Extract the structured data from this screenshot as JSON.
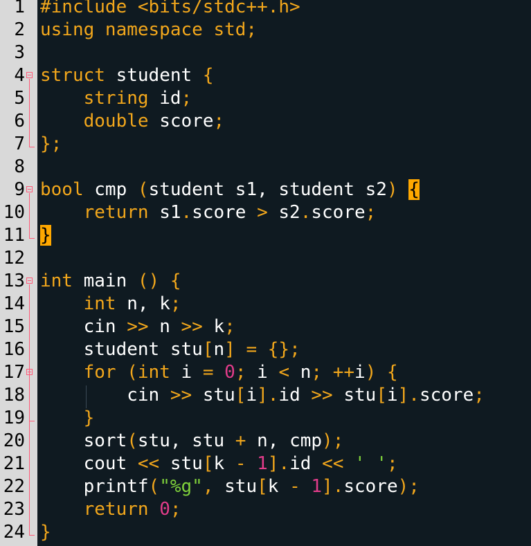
{
  "editor": {
    "name": "C++ source editor",
    "line_numbers": [
      "1",
      "2",
      "3",
      "4",
      "5",
      "6",
      "7",
      "8",
      "9",
      "10",
      "11",
      "12",
      "13",
      "14",
      "15",
      "16",
      "17",
      "18",
      "19",
      "20",
      "21",
      "22",
      "23",
      "24"
    ],
    "lines": [
      [
        {
          "t": "#include <bits/stdc++.h>",
          "c": "pp"
        }
      ],
      [
        {
          "t": "using namespace std",
          "c": "ty"
        },
        {
          "t": ";",
          "c": "op"
        }
      ],
      [],
      [
        {
          "t": "struct ",
          "c": "ty"
        },
        {
          "t": "student ",
          "c": "id"
        },
        {
          "t": "{",
          "c": "op"
        }
      ],
      [
        {
          "t": "    ",
          "c": "id"
        },
        {
          "t": "string ",
          "c": "ty"
        },
        {
          "t": "id",
          "c": "id"
        },
        {
          "t": ";",
          "c": "op"
        }
      ],
      [
        {
          "t": "    ",
          "c": "id"
        },
        {
          "t": "double ",
          "c": "ty"
        },
        {
          "t": "score",
          "c": "id"
        },
        {
          "t": ";",
          "c": "op"
        }
      ],
      [
        {
          "t": "}",
          "c": "op"
        },
        {
          "t": ";",
          "c": "op"
        }
      ],
      [],
      [
        {
          "t": "bool ",
          "c": "ty"
        },
        {
          "t": "cmp ",
          "c": "id"
        },
        {
          "t": "(",
          "c": "op"
        },
        {
          "t": "student ",
          "c": "id"
        },
        {
          "t": "s1, ",
          "c": "id"
        },
        {
          "t": "student ",
          "c": "id"
        },
        {
          "t": "s2",
          "c": "id"
        },
        {
          "t": ") ",
          "c": "op"
        },
        {
          "t": "{",
          "c": "match"
        }
      ],
      [
        {
          "t": "    ",
          "c": "id"
        },
        {
          "t": "return ",
          "c": "ctl"
        },
        {
          "t": "s1",
          "c": "id"
        },
        {
          "t": ".",
          "c": "op"
        },
        {
          "t": "score ",
          "c": "id"
        },
        {
          "t": "> ",
          "c": "op"
        },
        {
          "t": "s2",
          "c": "id"
        },
        {
          "t": ".",
          "c": "op"
        },
        {
          "t": "score",
          "c": "id"
        },
        {
          "t": ";",
          "c": "op"
        }
      ],
      [
        {
          "t": "}",
          "c": "match"
        }
      ],
      [],
      [
        {
          "t": "int ",
          "c": "ty"
        },
        {
          "t": "main ",
          "c": "id"
        },
        {
          "t": "() ",
          "c": "op"
        },
        {
          "t": "{",
          "c": "op"
        }
      ],
      [
        {
          "t": "    ",
          "c": "id"
        },
        {
          "t": "int ",
          "c": "ty"
        },
        {
          "t": "n, k",
          "c": "id"
        },
        {
          "t": ";",
          "c": "op"
        }
      ],
      [
        {
          "t": "    ",
          "c": "id"
        },
        {
          "t": "cin ",
          "c": "id"
        },
        {
          "t": ">> ",
          "c": "op"
        },
        {
          "t": "n ",
          "c": "id"
        },
        {
          "t": ">> ",
          "c": "op"
        },
        {
          "t": "k",
          "c": "id"
        },
        {
          "t": ";",
          "c": "op"
        }
      ],
      [
        {
          "t": "    ",
          "c": "id"
        },
        {
          "t": "student ",
          "c": "id"
        },
        {
          "t": "stu",
          "c": "id"
        },
        {
          "t": "[",
          "c": "op"
        },
        {
          "t": "n",
          "c": "id"
        },
        {
          "t": "] = {}",
          "c": "op"
        },
        {
          "t": ";",
          "c": "op"
        }
      ],
      [
        {
          "t": "    ",
          "c": "id"
        },
        {
          "t": "for ",
          "c": "ctl"
        },
        {
          "t": "(",
          "c": "op"
        },
        {
          "t": "int ",
          "c": "ty"
        },
        {
          "t": "i ",
          "c": "id"
        },
        {
          "t": "= ",
          "c": "op"
        },
        {
          "t": "0",
          "c": "num"
        },
        {
          "t": "; ",
          "c": "op"
        },
        {
          "t": "i ",
          "c": "id"
        },
        {
          "t": "< ",
          "c": "op"
        },
        {
          "t": "n",
          "c": "id"
        },
        {
          "t": "; ",
          "c": "op"
        },
        {
          "t": "++",
          "c": "op"
        },
        {
          "t": "i",
          "c": "id"
        },
        {
          "t": ") {",
          "c": "op"
        }
      ],
      [
        {
          "t": "        ",
          "c": "id"
        },
        {
          "t": "cin ",
          "c": "id"
        },
        {
          "t": ">> ",
          "c": "op"
        },
        {
          "t": "stu",
          "c": "id"
        },
        {
          "t": "[",
          "c": "op"
        },
        {
          "t": "i",
          "c": "id"
        },
        {
          "t": "]",
          "c": "op"
        },
        {
          "t": ".",
          "c": "op"
        },
        {
          "t": "id ",
          "c": "id"
        },
        {
          "t": ">> ",
          "c": "op"
        },
        {
          "t": "stu",
          "c": "id"
        },
        {
          "t": "[",
          "c": "op"
        },
        {
          "t": "i",
          "c": "id"
        },
        {
          "t": "]",
          "c": "op"
        },
        {
          "t": ".",
          "c": "op"
        },
        {
          "t": "score",
          "c": "id"
        },
        {
          "t": ";",
          "c": "op"
        }
      ],
      [
        {
          "t": "    ",
          "c": "id"
        },
        {
          "t": "}",
          "c": "op"
        }
      ],
      [
        {
          "t": "    ",
          "c": "id"
        },
        {
          "t": "sort",
          "c": "id"
        },
        {
          "t": "(",
          "c": "op"
        },
        {
          "t": "stu, stu ",
          "c": "id"
        },
        {
          "t": "+ ",
          "c": "op"
        },
        {
          "t": "n, cmp",
          "c": "id"
        },
        {
          "t": ")",
          "c": "op"
        },
        {
          "t": ";",
          "c": "op"
        }
      ],
      [
        {
          "t": "    ",
          "c": "id"
        },
        {
          "t": "cout ",
          "c": "id"
        },
        {
          "t": "<< ",
          "c": "op"
        },
        {
          "t": "stu",
          "c": "id"
        },
        {
          "t": "[",
          "c": "op"
        },
        {
          "t": "k ",
          "c": "id"
        },
        {
          "t": "- ",
          "c": "op"
        },
        {
          "t": "1",
          "c": "num"
        },
        {
          "t": "]",
          "c": "op"
        },
        {
          "t": ".",
          "c": "op"
        },
        {
          "t": "id ",
          "c": "id"
        },
        {
          "t": "<< ",
          "c": "op"
        },
        {
          "t": "' '",
          "c": "str"
        },
        {
          "t": ";",
          "c": "op"
        }
      ],
      [
        {
          "t": "    ",
          "c": "id"
        },
        {
          "t": "printf",
          "c": "id"
        },
        {
          "t": "(",
          "c": "op"
        },
        {
          "t": "\"%g\"",
          "c": "str"
        },
        {
          "t": ", ",
          "c": "op"
        },
        {
          "t": "stu",
          "c": "id"
        },
        {
          "t": "[",
          "c": "op"
        },
        {
          "t": "k ",
          "c": "id"
        },
        {
          "t": "- ",
          "c": "op"
        },
        {
          "t": "1",
          "c": "num"
        },
        {
          "t": "]",
          "c": "op"
        },
        {
          "t": ".",
          "c": "op"
        },
        {
          "t": "score",
          "c": "id"
        },
        {
          "t": ")",
          "c": "op"
        },
        {
          "t": ";",
          "c": "op"
        }
      ],
      [
        {
          "t": "    ",
          "c": "id"
        },
        {
          "t": "return ",
          "c": "ctl"
        },
        {
          "t": "0",
          "c": "num"
        },
        {
          "t": ";",
          "c": "op"
        }
      ],
      [
        {
          "t": "}",
          "c": "op"
        }
      ]
    ],
    "fold_markers": [
      4,
      9,
      13,
      17
    ],
    "colors": {
      "background": "#0f1a21",
      "gutter": "#d9d9d9",
      "keyword": "#f2a71c",
      "number": "#e23c8a",
      "string": "#7fd13b",
      "bracket_match": "#ffa800",
      "fold_marker": "#ff5a78"
    }
  }
}
